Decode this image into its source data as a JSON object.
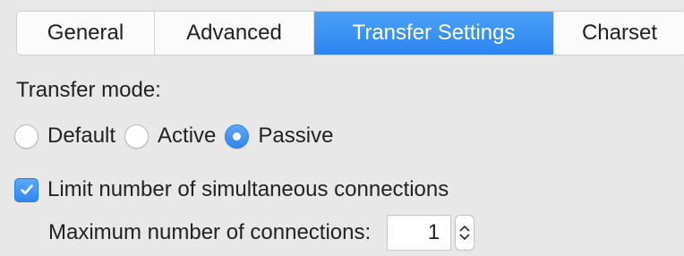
{
  "tabs": [
    {
      "label": "General",
      "active": false
    },
    {
      "label": "Advanced",
      "active": false
    },
    {
      "label": "Transfer Settings",
      "active": true
    },
    {
      "label": "Charset",
      "active": false
    }
  ],
  "transfer_mode": {
    "label": "Transfer mode:",
    "options": [
      {
        "label": "Default",
        "checked": false
      },
      {
        "label": "Active",
        "checked": false
      },
      {
        "label": "Passive",
        "checked": true
      }
    ]
  },
  "limit_connections": {
    "label": "Limit number of simultaneous connections",
    "checked": true
  },
  "max_connections": {
    "label": "Maximum number of connections:",
    "value": "1"
  },
  "colors": {
    "accent": "#2f86ef",
    "background": "#e8e8e8"
  },
  "icons": {
    "checkbox_mark": "checkmark-icon",
    "stepper": "stepper-arrows-icon"
  }
}
